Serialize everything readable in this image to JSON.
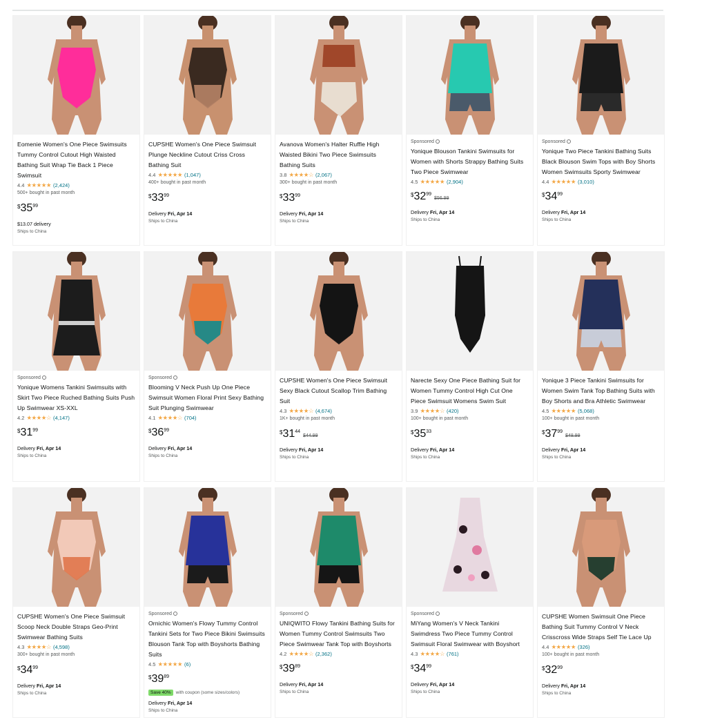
{
  "products": [
    {
      "sponsored": "",
      "title": "Eomenie Women's One Piece Swimsuits Tummy Control Cutout High Waisted Bathing Suit Wrap Tie Back 1 Piece Swimsuit",
      "rating": "4.4",
      "stars": "★★★★★",
      "count": "(2,424)",
      "bought": "500+ bought in past month",
      "price_symbol": "$",
      "price_whole": "35",
      "price_fraction": "99",
      "list_price": "",
      "coupon_badge": "",
      "coupon_text": "",
      "delivery_prefix": "$13.07 delivery",
      "delivery_date": "",
      "ships": "Ships to China",
      "colors": {
        "top": "#ff2d9a",
        "bottom": "#ff2d9a",
        "skin": "#c99174"
      },
      "style": "one"
    },
    {
      "sponsored": "",
      "title": "CUPSHE Women's One Piece Swimsuit Plunge Neckline Cutout Criss Cross Bathing Suit",
      "rating": "4.4",
      "stars": "★★★★★",
      "count": "(1,047)",
      "bought": "400+ bought in past month",
      "price_symbol": "$",
      "price_whole": "33",
      "price_fraction": "99",
      "list_price": "",
      "coupon_badge": "",
      "coupon_text": "",
      "delivery_prefix": "Delivery",
      "delivery_date": "Fri, Apr 14",
      "ships": "Ships to China",
      "colors": {
        "top": "#3a2a20",
        "bottom": "#b07e63",
        "skin": "#c8916f"
      },
      "style": "one"
    },
    {
      "sponsored": "",
      "title": "Avanova Women's Halter Ruffle High Waisted Bikini Two Piece Swimsuits Bathing Suits",
      "rating": "3.8",
      "stars": "★★★★☆",
      "count": "(2,067)",
      "bought": "300+ bought in past month",
      "price_symbol": "$",
      "price_whole": "33",
      "price_fraction": "99",
      "list_price": "",
      "coupon_badge": "",
      "coupon_text": "",
      "delivery_prefix": "Delivery",
      "delivery_date": "Fri, Apr 14",
      "ships": "Ships to China",
      "colors": {
        "top": "#a0472a",
        "bottom": "#e8ddd0",
        "skin": "#c99174"
      },
      "style": "bikini"
    },
    {
      "sponsored": "Sponsored",
      "title": "Yonique Blouson Tankini Swimsuits for Women with Shorts Strappy Bathing Suits Two Piece Swimwear",
      "rating": "4.5",
      "stars": "★★★★★",
      "count": "(2,904)",
      "bought": "",
      "price_symbol": "$",
      "price_whole": "32",
      "price_fraction": "99",
      "list_price": "$56.99",
      "coupon_badge": "",
      "coupon_text": "",
      "delivery_prefix": "Delivery",
      "delivery_date": "Fri, Apr 14",
      "ships": "Ships to China",
      "colors": {
        "top": "#27c9b0",
        "bottom": "#4a5a6a",
        "skin": "#c99174"
      },
      "style": "tankini"
    },
    {
      "sponsored": "Sponsored",
      "title": "Yonique Two Piece Tankini Bathing Suits Black Blouson Swim Tops with Boy Shorts Women Swimsuits Sporty Swimwear",
      "rating": "4.4",
      "stars": "★★★★★",
      "count": "(3,010)",
      "bought": "",
      "price_symbol": "$",
      "price_whole": "34",
      "price_fraction": "99",
      "list_price": "",
      "coupon_badge": "",
      "coupon_text": "",
      "delivery_prefix": "Delivery",
      "delivery_date": "Fri, Apr 14",
      "ships": "Ships to China",
      "colors": {
        "top": "#1b1b1b",
        "bottom": "#2a2a2a",
        "skin": "#c99174"
      },
      "style": "tankini"
    },
    {
      "sponsored": "Sponsored",
      "title": "Yonique Womens Tankini Swimsuits with Skirt Two Piece Ruched Bathing Suits Push Up Swimwear XS-XXL",
      "rating": "4.2",
      "stars": "★★★★☆",
      "count": "(4,147)",
      "bought": "",
      "price_symbol": "$",
      "price_whole": "31",
      "price_fraction": "99",
      "list_price": "",
      "coupon_badge": "",
      "coupon_text": "",
      "delivery_prefix": "Delivery",
      "delivery_date": "Fri, Apr 14",
      "ships": "Ships to China",
      "colors": {
        "top": "#1c1c1c",
        "bottom": "#1c1c1c",
        "skin": "#c99174"
      },
      "style": "skirt"
    },
    {
      "sponsored": "Sponsored",
      "title": "Blooming V Neck Push Up One Piece Swimsuit Women Floral Print Sexy Bathing Suit Plunging Swimwear",
      "rating": "4.1",
      "stars": "★★★★☆",
      "count": "(704)",
      "bought": "",
      "price_symbol": "$",
      "price_whole": "36",
      "price_fraction": "99",
      "list_price": "",
      "coupon_badge": "",
      "coupon_text": "",
      "delivery_prefix": "Delivery",
      "delivery_date": "Fri, Apr 14",
      "ships": "Ships to China",
      "colors": {
        "top": "#e87a3a",
        "bottom": "#1b8a8a",
        "skin": "#c99174"
      },
      "style": "one"
    },
    {
      "sponsored": "",
      "title": "CUPSHE Women's One Piece Swimsuit Sexy Black Cutout Scallop Trim Bathing Suit",
      "rating": "4.3",
      "stars": "★★★★☆",
      "count": "(4,674)",
      "bought": "1K+ bought in past month",
      "price_symbol": "$",
      "price_whole": "31",
      "price_fraction": "44",
      "list_price": "$44.99",
      "coupon_badge": "",
      "coupon_text": "",
      "delivery_prefix": "Delivery",
      "delivery_date": "Fri, Apr 14",
      "ships": "Ships to China",
      "colors": {
        "top": "#141414",
        "bottom": "#141414",
        "skin": "#c99174"
      },
      "style": "one"
    },
    {
      "sponsored": "",
      "title": "Narecte Sexy One Piece Bathing Suit for Women Tummy Control High Cut One Piece Swimsuit Womens Swim Suit",
      "rating": "3.9",
      "stars": "★★★★☆",
      "count": "(420)",
      "bought": "100+ bought in past month",
      "price_symbol": "$",
      "price_whole": "35",
      "price_fraction": "33",
      "list_price": "",
      "coupon_badge": "",
      "coupon_text": "",
      "delivery_prefix": "Delivery",
      "delivery_date": "Fri, Apr 14",
      "ships": "Ships to China",
      "colors": {
        "top": "#151515",
        "bottom": "#151515",
        "skin": "#f2f2f2"
      },
      "style": "flat"
    },
    {
      "sponsored": "",
      "title": "Yonique 3 Piece Tankini Swimsuits for Women Swim Tank Top Bathing Suits with Boy Shorts and Bra Athletic Swimwear",
      "rating": "4.5",
      "stars": "★★★★★",
      "count": "(5,068)",
      "bought": "100+ bought in past month",
      "price_symbol": "$",
      "price_whole": "37",
      "price_fraction": "99",
      "list_price": "$48.99",
      "coupon_badge": "",
      "coupon_text": "",
      "delivery_prefix": "Delivery",
      "delivery_date": "Fri, Apr 14",
      "ships": "Ships to China",
      "colors": {
        "top": "#24305a",
        "bottom": "#c8ccd8",
        "skin": "#c99174"
      },
      "style": "tankini"
    },
    {
      "sponsored": "",
      "title": "CUPSHE Women's One Piece Swimsuit Scoop Neck Double Straps Geo-Print Swimwear Bathing Suits",
      "rating": "4.3",
      "stars": "★★★★☆",
      "count": "(4,598)",
      "bought": "300+ bought in past month",
      "price_symbol": "$",
      "price_whole": "34",
      "price_fraction": "99",
      "list_price": "",
      "coupon_badge": "",
      "coupon_text": "",
      "delivery_prefix": "Delivery",
      "delivery_date": "Fri, Apr 14",
      "ships": "Ships to China",
      "colors": {
        "top": "#f2c9b8",
        "bottom": "#e07a50",
        "skin": "#c99174"
      },
      "style": "one"
    },
    {
      "sponsored": "Sponsored",
      "title": "Ornichic Women's Flowy Tummy Control Tankini Sets for Two Piece Bikini Swimsuits Blouson Tank Top with Boyshorts Bathing Suits",
      "rating": "4.5",
      "stars": "★★★★★",
      "count": "(6)",
      "bought": "",
      "price_symbol": "$",
      "price_whole": "39",
      "price_fraction": "89",
      "list_price": "",
      "coupon_badge": "Save 40%",
      "coupon_text": "with coupon (some sizes/colors)",
      "delivery_prefix": "Delivery",
      "delivery_date": "Fri, Apr 14",
      "ships": "Ships to China",
      "colors": {
        "top": "#27329a",
        "bottom": "#1b1b1b",
        "skin": "#c99174"
      },
      "style": "tankini"
    },
    {
      "sponsored": "Sponsored",
      "title": "UNIQWITO Flowy Tankini Bathing Suits for Women Tummy Control Swimsuits Two Piece Swimwear Tank Top with Boyshorts",
      "rating": "4.2",
      "stars": "★★★★☆",
      "count": "(2,362)",
      "bought": "",
      "price_symbol": "$",
      "price_whole": "39",
      "price_fraction": "89",
      "list_price": "",
      "coupon_badge": "",
      "coupon_text": "",
      "delivery_prefix": "Delivery",
      "delivery_date": "Fri, Apr 14",
      "ships": "Ships to China",
      "colors": {
        "top": "#1e8a6a",
        "bottom": "#151515",
        "skin": "#c99174"
      },
      "style": "tankini"
    },
    {
      "sponsored": "Sponsored",
      "title": "MiYang Women's V Neck Tankini Swimdress Two Piece Tummy Control Swimsuit Floral Swimwear with Boyshort",
      "rating": "4.3",
      "stars": "★★★★☆",
      "count": "(761)",
      "bought": "",
      "price_symbol": "$",
      "price_whole": "34",
      "price_fraction": "99",
      "list_price": "",
      "coupon_badge": "",
      "coupon_text": "",
      "delivery_prefix": "Delivery",
      "delivery_date": "Fri, Apr 14",
      "ships": "Ships to China",
      "colors": {
        "top": "#e8d8e0",
        "bottom": "#2a1a22",
        "skin": "#f2f2f2"
      },
      "style": "dress"
    },
    {
      "sponsored": "",
      "title": "CUPSHE Women Swimsuit One Piece Bathing Suit Tummy Control V Neck Crisscross Wide Straps Self Tie Lace Up",
      "rating": "4.4",
      "stars": "★★★★★",
      "count": "(326)",
      "bought": "100+ bought in past month",
      "price_symbol": "$",
      "price_whole": "32",
      "price_fraction": "99",
      "list_price": "",
      "coupon_badge": "",
      "coupon_text": "",
      "delivery_prefix": "Delivery",
      "delivery_date": "Fri, Apr 14",
      "ships": "Ships to China",
      "colors": {
        "top": "#d89a7a",
        "bottom": "#1c3a2c",
        "skin": "#c99174"
      },
      "style": "one"
    }
  ]
}
